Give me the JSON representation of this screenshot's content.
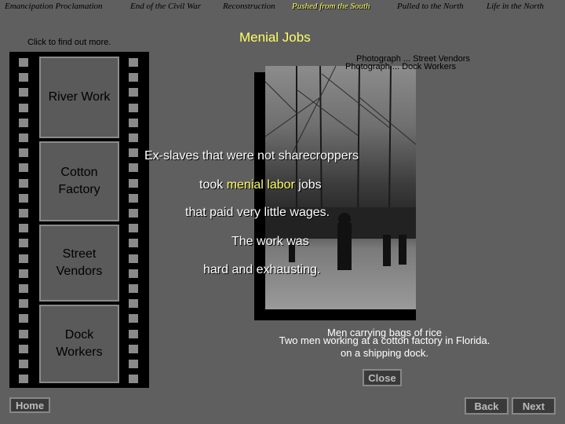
{
  "nav": [
    {
      "label": "Emancipation Proclamation"
    },
    {
      "label": "End of the Civil War"
    },
    {
      "label": "Reconstruction"
    },
    {
      "label": "Pushed from the South"
    },
    {
      "label": "Pulled to the North"
    },
    {
      "label": "Life in the North"
    }
  ],
  "hint": "Click to find out more.",
  "page_title": "Menial Jobs",
  "photo_links": "Photograph ... Street Vendors",
  "photo_links_overlap": "Photograph ... Dock Workers",
  "filmstrip": [
    "River Work",
    "Cotton Factory",
    "Street Vendors",
    "Dock Workers"
  ],
  "body_lines": {
    "l1": "Ex-slaves that were not sharecroppers",
    "l2a": "took ",
    "l2b": "menial labor",
    "l2c": " jobs",
    "l3": "that paid very little wages.",
    "l4": "The work was",
    "l5": "hard and exhausting."
  },
  "caption": {
    "line1": "Two men working at a cotton factory in Florida.",
    "line1_overlap": "Men carrying bags of rice",
    "line2": "on a shipping dock."
  },
  "buttons": {
    "close": "Close",
    "home": "Home",
    "back": "Back",
    "next": "Next"
  }
}
